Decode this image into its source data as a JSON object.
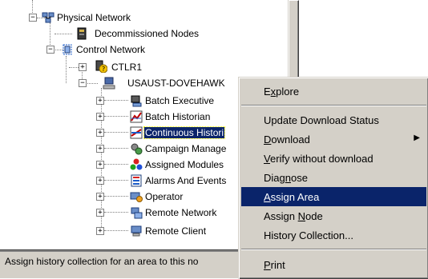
{
  "tree": {
    "nodes": [
      {
        "key": "physical_network",
        "label": "Physical Network",
        "icon": "physical-network-icon",
        "expander": "minus"
      },
      {
        "key": "decommissioned_nodes",
        "label": "Decommissioned Nodes",
        "icon": "decommissioned-nodes-icon"
      },
      {
        "key": "control_network",
        "label": "Control Network",
        "icon": "control-network-icon",
        "expander": "minus"
      },
      {
        "key": "ctlr1",
        "label": "CTLR1",
        "icon": "controller-warning-icon",
        "expander": "plus"
      },
      {
        "key": "usaust",
        "label": "USAUST-DOVEHAWK",
        "icon": "workstation-icon",
        "expander": "minus"
      },
      {
        "key": "batch_executive",
        "label": "Batch Executive",
        "icon": "batch-executive-icon",
        "expander": "plus"
      },
      {
        "key": "batch_historian",
        "label": "Batch Historian",
        "icon": "batch-historian-icon",
        "expander": "plus"
      },
      {
        "key": "continuous_historian",
        "label": "Continuous Histori",
        "icon": "continuous-historian-icon",
        "expander": "plus",
        "selected": true
      },
      {
        "key": "campaign_manager",
        "label": "Campaign Manage",
        "icon": "campaign-manager-icon",
        "expander": "plus"
      },
      {
        "key": "assigned_modules",
        "label": "Assigned Modules",
        "icon": "assigned-modules-icon",
        "expander": "plus"
      },
      {
        "key": "alarms_events",
        "label": "Alarms And Events",
        "icon": "alarms-events-icon",
        "expander": "plus"
      },
      {
        "key": "operator",
        "label": "Operator",
        "icon": "operator-icon",
        "expander": "plus"
      },
      {
        "key": "remote_network",
        "label": "Remote Network",
        "icon": "remote-network-icon",
        "expander": "plus"
      },
      {
        "key": "remote_client",
        "label": "Remote Client",
        "icon": "remote-client-icon",
        "expander": "plus"
      }
    ]
  },
  "status_bar": {
    "text": "Assign history collection for an area to this no"
  },
  "context_menu": {
    "items": {
      "explore": {
        "pre": "E",
        "u": "x",
        "post": "plore"
      },
      "update_download_status": {
        "pre": "",
        "u": "",
        "post": "Update Download Status"
      },
      "download": {
        "pre": "",
        "u": "D",
        "post": "ownload"
      },
      "verify": {
        "pre": "",
        "u": "V",
        "post": "erify without download"
      },
      "diagnose": {
        "pre": "Diag",
        "u": "n",
        "post": "ose"
      },
      "assign_area": {
        "pre": "",
        "u": "A",
        "post": "ssign Area"
      },
      "assign_node": {
        "pre": "Assign ",
        "u": "N",
        "post": "ode"
      },
      "history_collection": {
        "pre": "",
        "u": "",
        "post": "History Collection..."
      },
      "print": {
        "pre": "",
        "u": "P",
        "post": "rint"
      }
    },
    "submenu_arrow": "▶"
  },
  "colors": {
    "highlight": "#0a246a",
    "chrome": "#d4d0c8"
  }
}
